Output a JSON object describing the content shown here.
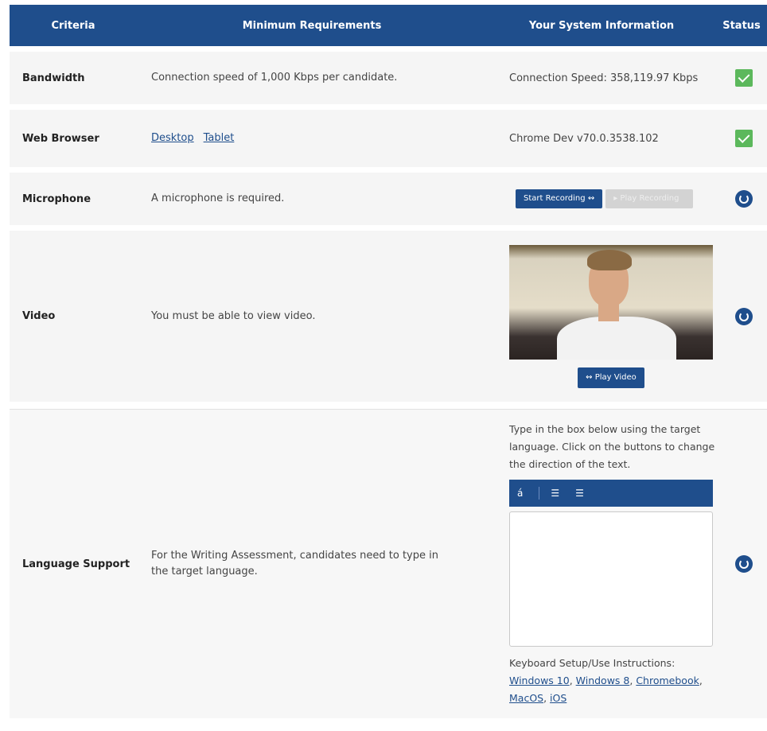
{
  "header": {
    "criteria": "Criteria",
    "min_requirements": "Minimum Requirements",
    "system_info": "Your System Information",
    "status": "Status"
  },
  "rows": {
    "bandwidth": {
      "criteria": "Bandwidth",
      "requirement": "Connection speed of 1,000 Kbps per candidate.",
      "system": "Connection Speed: 358,119.97 Kbps",
      "status_icon": "check-icon"
    },
    "browser": {
      "criteria": "Web Browser",
      "link_desktop": "Desktop",
      "link_tablet": "Tablet",
      "system": "Chrome Dev v70.0.3538.102",
      "status_icon": "check-icon"
    },
    "microphone": {
      "criteria": "Microphone",
      "requirement": "A microphone is required.",
      "start_recording": "Start Recording",
      "play_recording": "Play Recording",
      "status_icon": "loading-icon"
    },
    "video": {
      "criteria": "Video",
      "requirement": "You must be able to view video.",
      "play_video": "Play Video",
      "status_icon": "loading-icon"
    },
    "language": {
      "criteria": "Language Support",
      "requirement": "For the Writing Assessment, candidates need to type in the target language.",
      "instructions": "Type in the box below using the target language. Click on the buttons to change the direction of the text.",
      "toolbar_char": "á",
      "keyboard_label": "Keyboard Setup/Use Instructions:",
      "links": [
        "Windows 10",
        "Windows 8",
        "Chromebook",
        "MacOS",
        "iOS"
      ],
      "status_icon": "loading-icon"
    }
  },
  "colors": {
    "brand": "#1f4e8c",
    "success": "#5cb85c",
    "row_bg": "#f5f5f5"
  }
}
